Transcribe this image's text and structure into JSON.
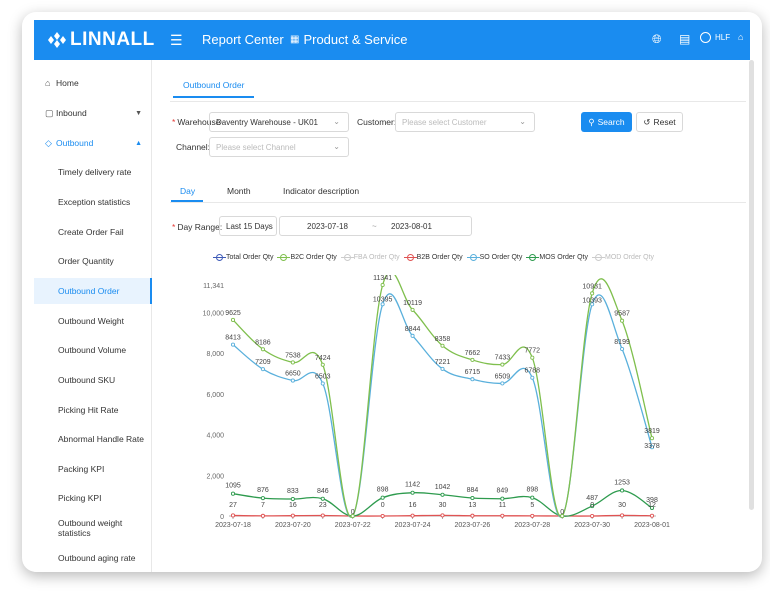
{
  "header": {
    "logo_text": "LINNALL",
    "report_center": "Report Center",
    "product_service": "Product & Service",
    "user": "HLF"
  },
  "sidebar": {
    "items": [
      {
        "label": "Home",
        "icon": "home-icon"
      },
      {
        "label": "Inbound",
        "icon": "inbound-icon"
      },
      {
        "label": "Outbound",
        "icon": "outbound-icon"
      },
      {
        "label": "Timely delivery rate"
      },
      {
        "label": "Exception statistics"
      },
      {
        "label": "Create Order Fail"
      },
      {
        "label": "Order Quantity"
      },
      {
        "label": "Outbound Order"
      },
      {
        "label": "Outbound Weight"
      },
      {
        "label": "Outbound Volume"
      },
      {
        "label": "Outbound SKU"
      },
      {
        "label": "Picking Hit Rate"
      },
      {
        "label": "Abnormal Handle Rate"
      },
      {
        "label": "Packing KPI"
      },
      {
        "label": "Picking KPI"
      },
      {
        "label": "Outbound weight statistics"
      },
      {
        "label": "Outbound aging rate"
      }
    ]
  },
  "tab_main": "Outbound Order",
  "filters": {
    "warehouse_label": "Warehouse",
    "warehouse_value": "Daventry Warehouse - UK01",
    "customer_label": "Customer:",
    "customer_placeholder": "Please select Customer",
    "channel_label": "Channel:",
    "channel_placeholder": "Please select Channel",
    "search_label": "Search",
    "reset_label": "Reset"
  },
  "sub_tabs": [
    "Day",
    "Month",
    "Indicator description"
  ],
  "range": {
    "label": "Day Range:",
    "preset": "Last 15 Days",
    "start": "2023-07-18",
    "sep": "~",
    "end": "2023-08-01"
  },
  "chart_data": {
    "type": "line",
    "x": [
      "2023-07-18",
      "2023-07-19",
      "2023-07-20",
      "2023-07-21",
      "2023-07-22",
      "2023-07-23",
      "2023-07-24",
      "2023-07-25",
      "2023-07-26",
      "2023-07-27",
      "2023-07-28",
      "2023-07-29",
      "2023-07-30",
      "2023-07-31",
      "2023-08-01"
    ],
    "x_tick_labels": [
      "2023-07-18",
      "2023-07-20",
      "2023-07-22",
      "2023-07-24",
      "2023-07-26",
      "2023-07-28",
      "2023-07-30",
      "2023-08-01"
    ],
    "y_ticks": [
      0,
      2000,
      4000,
      6000,
      8000,
      10000,
      11341
    ],
    "y_tick_labels": [
      "0",
      "2,000",
      "4,000",
      "6,000",
      "8,000",
      "10,000",
      "11,341"
    ],
    "ylim": [
      0,
      11341
    ],
    "series": [
      {
        "name": "Total Order Qty",
        "color": "#3f5bb8",
        "visible": true,
        "values": [
          null,
          null,
          null,
          null,
          null,
          null,
          null,
          null,
          null,
          null,
          null,
          null,
          null,
          null,
          null
        ]
      },
      {
        "name": "B2C Order Qty",
        "color": "#7fbf4d",
        "visible": true,
        "values": [
          9625,
          8186,
          7538,
          7424,
          0,
          11341,
          10119,
          8358,
          7662,
          7433,
          7772,
          0,
          10931,
          9587,
          3819
        ]
      },
      {
        "name": "FBA Order Qty",
        "color": "#cccccc",
        "visible": false,
        "values": []
      },
      {
        "name": "B2B Order Qty",
        "color": "#e05353",
        "visible": true,
        "values": [
          27,
          7,
          16,
          23,
          0,
          0,
          16,
          30,
          13,
          11,
          5,
          0,
          0,
          30,
          12
        ]
      },
      {
        "name": "SO Order Qty",
        "color": "#5ab0dc",
        "visible": true,
        "values": [
          8413,
          7209,
          6650,
          6503,
          0,
          10395,
          8844,
          7221,
          6715,
          6509,
          6788,
          0,
          10393,
          8199,
          3378
        ]
      },
      {
        "name": "MOS Order Qty",
        "color": "#2e9b4e",
        "visible": true,
        "values": [
          1095,
          876,
          833,
          846,
          0,
          898,
          1142,
          1042,
          884,
          849,
          898,
          0,
          487,
          1253,
          398
        ]
      },
      {
        "name": "MOD Order Qty",
        "color": "#cccccc",
        "visible": false,
        "values": []
      }
    ],
    "low_labels": {
      "b2b": [
        "27",
        "7",
        "16",
        "23",
        "0",
        "0",
        "16",
        "30",
        "13",
        "11",
        "5",
        "0",
        "0",
        "30",
        "12"
      ]
    },
    "legend_position": "top"
  }
}
